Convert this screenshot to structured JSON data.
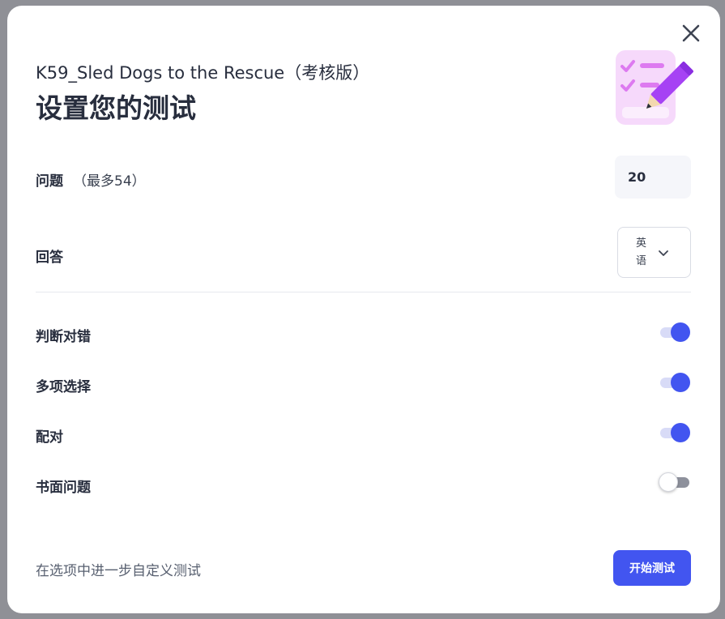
{
  "header": {
    "set_name": "K59_Sled Dogs to the Rescue（考核版）",
    "title": "设置您的测试"
  },
  "icons": {
    "close": "close-icon",
    "illustration": "test-checklist-pencil-icon",
    "dropdown": "chevron-down-icon"
  },
  "questions": {
    "label": "问题",
    "hint": "（最多54）",
    "value": "20"
  },
  "answer": {
    "label": "回答",
    "selected_language": "英语"
  },
  "question_types": [
    {
      "label": "判断对错",
      "enabled": true
    },
    {
      "label": "多项选择",
      "enabled": true
    },
    {
      "label": "配对",
      "enabled": true
    },
    {
      "label": "书面问题",
      "enabled": false
    }
  ],
  "footer": {
    "customize_link": "在选项中进一步自定义测试",
    "start_button": "开始测试"
  },
  "colors": {
    "accent": "#4255f0",
    "text": "#282e3e",
    "toggle_off": "#8e919c",
    "illustration_bg": "#f6d9fb",
    "pencil": "#a642f4"
  }
}
